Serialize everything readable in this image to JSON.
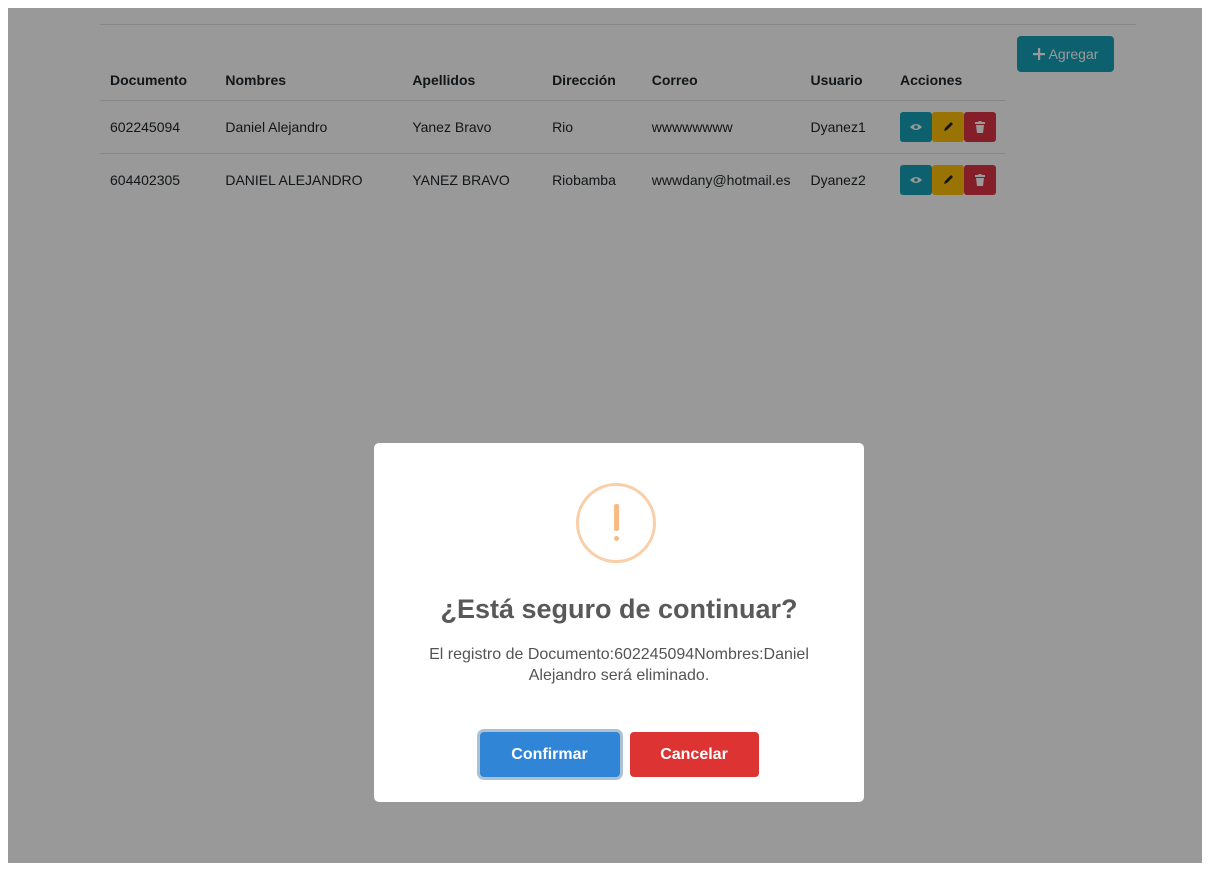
{
  "table": {
    "headers": [
      "Documento",
      "Nombres",
      "Apellidos",
      "Dirección",
      "Correo",
      "Usuario",
      "Acciones"
    ],
    "rows": [
      {
        "documento": "602245094",
        "nombres": "Daniel Alejandro",
        "apellidos": "Yanez Bravo",
        "direccion": "Rio",
        "correo": "wwwwwwww",
        "usuario": "Dyanez1"
      },
      {
        "documento": "604402305",
        "nombres": "DANIEL ALEJANDRO",
        "apellidos": "YANEZ BRAVO",
        "direccion": "Riobamba",
        "correo": "wwwdany@hotmail.es",
        "usuario": "Dyanez2"
      }
    ],
    "action_icons": [
      "eye-icon",
      "pencil-icon",
      "trash-icon"
    ]
  },
  "toolbar": {
    "add_label": "Agregar",
    "add_icon": "plus-icon"
  },
  "modal": {
    "icon": "warning-icon",
    "title": "¿Está seguro de continuar?",
    "text": "El registro de Documento:602245094Nombres:Daniel Alejandro será eliminado.",
    "confirm_label": "Confirmar",
    "cancel_label": "Cancelar"
  },
  "colors": {
    "info": "#17a2b8",
    "warning": "#ffc107",
    "danger": "#dc3545",
    "confirm": "#3085d6",
    "cancel": "#dd3333",
    "overlay": "rgba(0,0,0,0.4)"
  }
}
